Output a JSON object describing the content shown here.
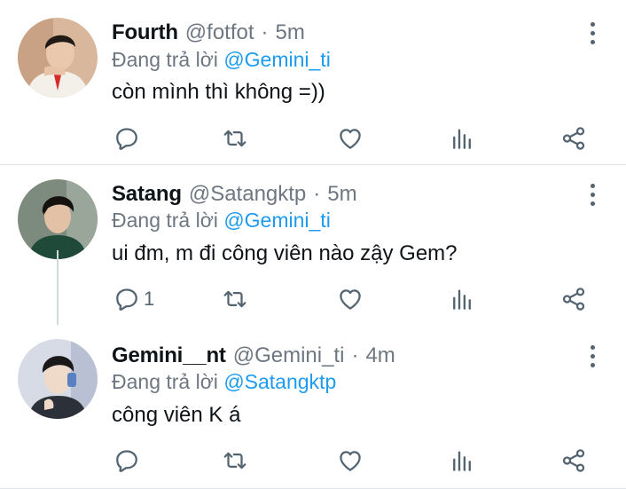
{
  "colors": {
    "text": "#0f1419",
    "secondary": "#6e7781",
    "mention": "#1d9bf0",
    "icon": "#536471",
    "divider": "#e1e5ea"
  },
  "tweets": [
    {
      "name": "Fourth",
      "handle": "@fotfot",
      "separator": "·",
      "time": "5m",
      "reply_prefix": "Đang trả lời",
      "reply_to": "@Gemini_ti",
      "text": "còn mình thì không =))",
      "reply_count": ""
    },
    {
      "name": "Satang",
      "handle": "@Satangktp",
      "separator": "·",
      "time": "5m",
      "reply_prefix": "Đang trả lời",
      "reply_to": "@Gemini_ti",
      "text": "ui đm, m đi công viên nào zậy Gem?",
      "reply_count": "1"
    },
    {
      "name": "Gemini__nt",
      "handle": "@Gemini_ti",
      "separator": "·",
      "time": "4m",
      "reply_prefix": "Đang trả lời",
      "reply_to": "@Satangktp",
      "text": "công viên K á",
      "reply_count": ""
    }
  ],
  "icons": [
    "reply-icon",
    "retweet-icon",
    "like-icon",
    "analytics-icon",
    "share-icon",
    "more-options-icon"
  ]
}
